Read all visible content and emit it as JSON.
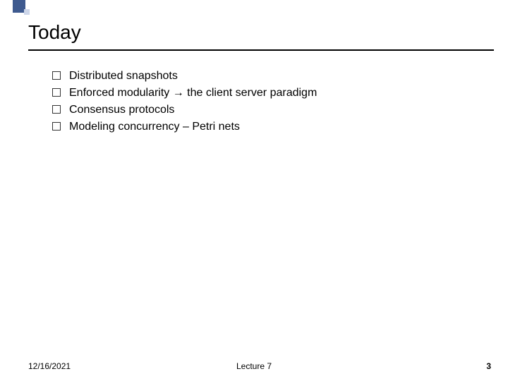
{
  "title": "Today",
  "bullets": [
    {
      "text": "Distributed snapshots"
    },
    {
      "text": "Enforced modularity → the client server paradigm"
    },
    {
      "text": "Consensus protocols"
    },
    {
      "text": "Modeling concurrency – Petri nets"
    }
  ],
  "footer": {
    "date": "12/16/2021",
    "center": "Lecture 7",
    "page": "3"
  }
}
